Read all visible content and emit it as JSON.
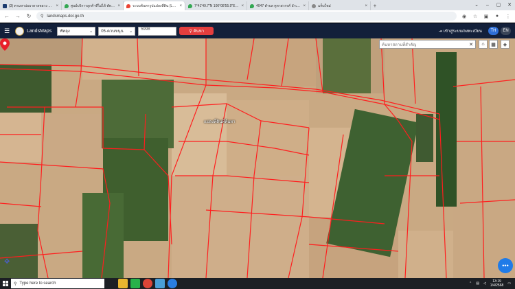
{
  "browser": {
    "tabs": [
      {
        "title": "(3) ตามหาบ่อบาดาลหลวง MB1608E...",
        "favicon_color": "#ffffff",
        "icon": "k-icon",
        "active": false
      },
      {
        "title": "ศูนย์บริการลูกค้าที่ไม่ได้ พัทลุง - Goo...",
        "favicon_color": "#34a853",
        "icon": "maps-pin-icon",
        "active": false
      },
      {
        "title": "ระบบค้นหารูปแปลงที่ดิน (LandsMa...",
        "favicon_color": "#ea4335",
        "icon": "maps-pin-icon",
        "active": true
      },
      {
        "title": "7°41'49.7\"N 100°08'55.9\"E - Go...",
        "favicon_color": "#34a853",
        "icon": "maps-pin-icon",
        "active": false
      },
      {
        "title": "4047 ตำบล คูหาสวรรค์ อำเภอเมือง...",
        "favicon_color": "#34a853",
        "icon": "maps-pin-icon",
        "active": false
      },
      {
        "title": "แท็บใหม่",
        "favicon_color": "#555555",
        "icon": "globe-icon",
        "active": false
      }
    ],
    "new_tab": "+",
    "url": "landsmaps.dol.go.th"
  },
  "app": {
    "brand": "LandsMaps",
    "province": "พัทลุง",
    "district": "05-ควนขนุน",
    "parcel_no": "5998",
    "search_label": "ค้นหา",
    "login_label": "เข้าสู่ระบบ/ลงทะเบียน",
    "lang_th": "TH",
    "lang_en": "EN",
    "accent": "#e43e3e",
    "header_bg": "#13203a"
  },
  "map": {
    "search_placeholder": "ค้นหาสถานที่สำคัญ",
    "parcel_label": "แปลงที่ดินที่ค้นหา",
    "marker_color": "#e8202a",
    "parcel_line_color": "#ff1e1e"
  },
  "taskbar": {
    "search_placeholder": "Type here to search",
    "time": "13:19",
    "date": "1/4/2568"
  }
}
